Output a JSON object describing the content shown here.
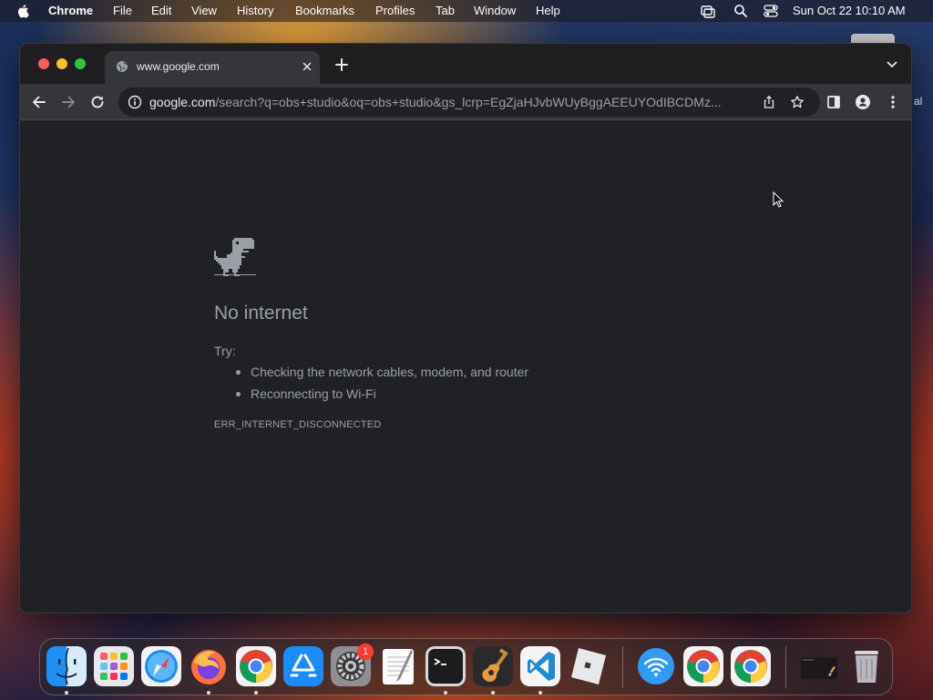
{
  "menubar": {
    "app_name": "Chrome",
    "items": [
      "File",
      "Edit",
      "View",
      "History",
      "Bookmarks",
      "Profiles",
      "Tab",
      "Window",
      "Help"
    ],
    "clock": "Sun Oct 22  10:10 AM"
  },
  "tab": {
    "title": "www.google.com"
  },
  "omnibox": {
    "host": "google.com",
    "path": "/search?q=obs+studio&oq=obs+studio&gs_lcrp=EgZjaHJvbWUyBggAEEUYOdIBCDMz..."
  },
  "error_page": {
    "title": "No internet",
    "try_label": "Try:",
    "suggestions": [
      "Checking the network cables, modem, and router",
      "Reconnecting to Wi-Fi"
    ],
    "error_code": "ERR_INTERNET_DISCONNECTED"
  },
  "desktop": {
    "edge_text": "al"
  },
  "dock": {
    "apps": [
      "Finder",
      "Launchpad",
      "Safari",
      "Firefox",
      "Google Chrome",
      "App Store",
      "System Settings",
      "TextEdit",
      "Terminal",
      "GarageBand",
      "Visual Studio Code",
      "Roblox",
      "Wireless Diagnostics",
      "Google Chrome",
      "Google Chrome",
      "Screenshot",
      "Trash"
    ],
    "settings_badge": "1"
  },
  "colors": {
    "page_bg": "#202124",
    "text_secondary": "#9aa0a6",
    "toolbar": "#35363a"
  }
}
